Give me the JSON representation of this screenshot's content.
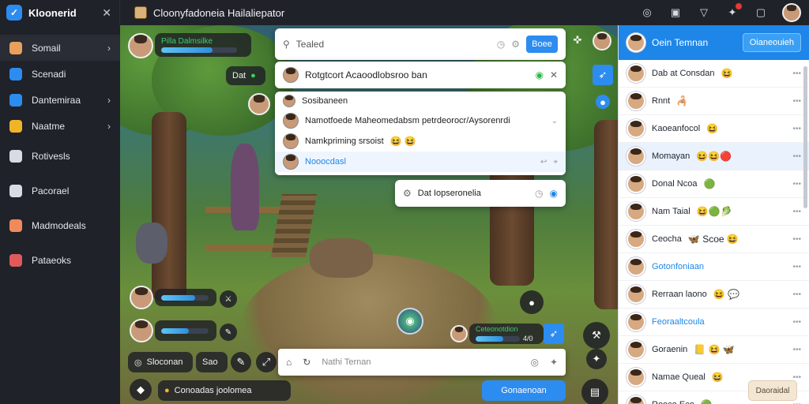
{
  "app": {
    "name": "Kloonerid",
    "title": "Cloonyfadoneia Hailaliepator"
  },
  "sidebar": {
    "items": [
      {
        "label": "Somail",
        "icon": "person-icon",
        "color": "#e8a15c",
        "chevron": true
      },
      {
        "label": "Scenadi",
        "icon": "pencil-icon",
        "color": "#2d8cf0",
        "chevron": false
      },
      {
        "label": "Dantemiraa",
        "icon": "bookmark-icon",
        "color": "#2d8cf0",
        "chevron": true
      },
      {
        "label": "Naatme",
        "icon": "star-tile-icon",
        "color": "#f0b429",
        "chevron": true
      },
      {
        "label": "Rotivesls",
        "icon": "square-icon",
        "color": "#d8dbe3",
        "chevron": false
      },
      {
        "label": "Pacorael",
        "icon": "chart-icon",
        "color": "#d8dbe3",
        "chevron": false
      },
      {
        "label": "Madmodeals",
        "icon": "home-icon",
        "color": "#f08a5c",
        "chevron": false
      },
      {
        "label": "Pataeoks",
        "icon": "shield-icon",
        "color": "#e05a5a",
        "chevron": false
      }
    ]
  },
  "scene": {
    "player_top": {
      "name": "Pilla Dalmsilke",
      "health": 0.68
    },
    "small_pill": {
      "label": "Dat"
    },
    "players_bottom_left": [
      {
        "health": 0.72
      },
      {
        "health": 0.58
      }
    ],
    "player_right": {
      "name": "Ceteonotdion",
      "health": 0.62,
      "count": "4/0"
    },
    "chips": [
      "Sloconan",
      "Sao"
    ],
    "coin_text": "Conoadas joolomea"
  },
  "search": {
    "placeholder": "Tealed",
    "button": "Boee",
    "result": "Rotgtcort Acaoodlobsroo ban"
  },
  "dropdown": {
    "header": "Sosibaneen",
    "rows": [
      {
        "text": "Namotfoede Maheomedabsm petrdeorocr/Aysorenrdi"
      },
      {
        "text": "Namkpriming srsoist",
        "emoji": "😆 😆"
      },
      {
        "text": "Nooocdasl",
        "link": true
      }
    ]
  },
  "toast": {
    "text": "Dat Iopseronelia"
  },
  "composer": {
    "placeholder": "Nathi Ternan"
  },
  "send_button": "Gonaenoan",
  "chat": {
    "header": "Oein Temnan",
    "header_button": "Oianeouieh",
    "rows": [
      {
        "name": "Dab at Consdan",
        "emoji": "😆"
      },
      {
        "name": "Rnnt",
        "emoji": "🦂"
      },
      {
        "name": "Kaoeanfocol",
        "emoji": "😆"
      },
      {
        "name": "Momayan",
        "emoji": "😆😆🔴"
      },
      {
        "name": "Donal Ncoa",
        "emoji": "🟢"
      },
      {
        "name": "Nam Taial",
        "emoji": "😆🟢🥬"
      },
      {
        "name": "Ceocha",
        "emoji": "🦋 Scoe 😆"
      },
      {
        "name": "Gotonfoniaan",
        "link": true
      },
      {
        "name": "Rerraan laono",
        "emoji": "😆 💬"
      },
      {
        "name": "Feoraaltcoula",
        "link": true
      },
      {
        "name": "Goraenin",
        "emoji": "📒 😆 🦋"
      },
      {
        "name": "Namae Queal",
        "emoji": "😆"
      },
      {
        "name": "Rooco Eco",
        "emoji": "🟢"
      }
    ],
    "footer_button": "Daoraidal"
  }
}
